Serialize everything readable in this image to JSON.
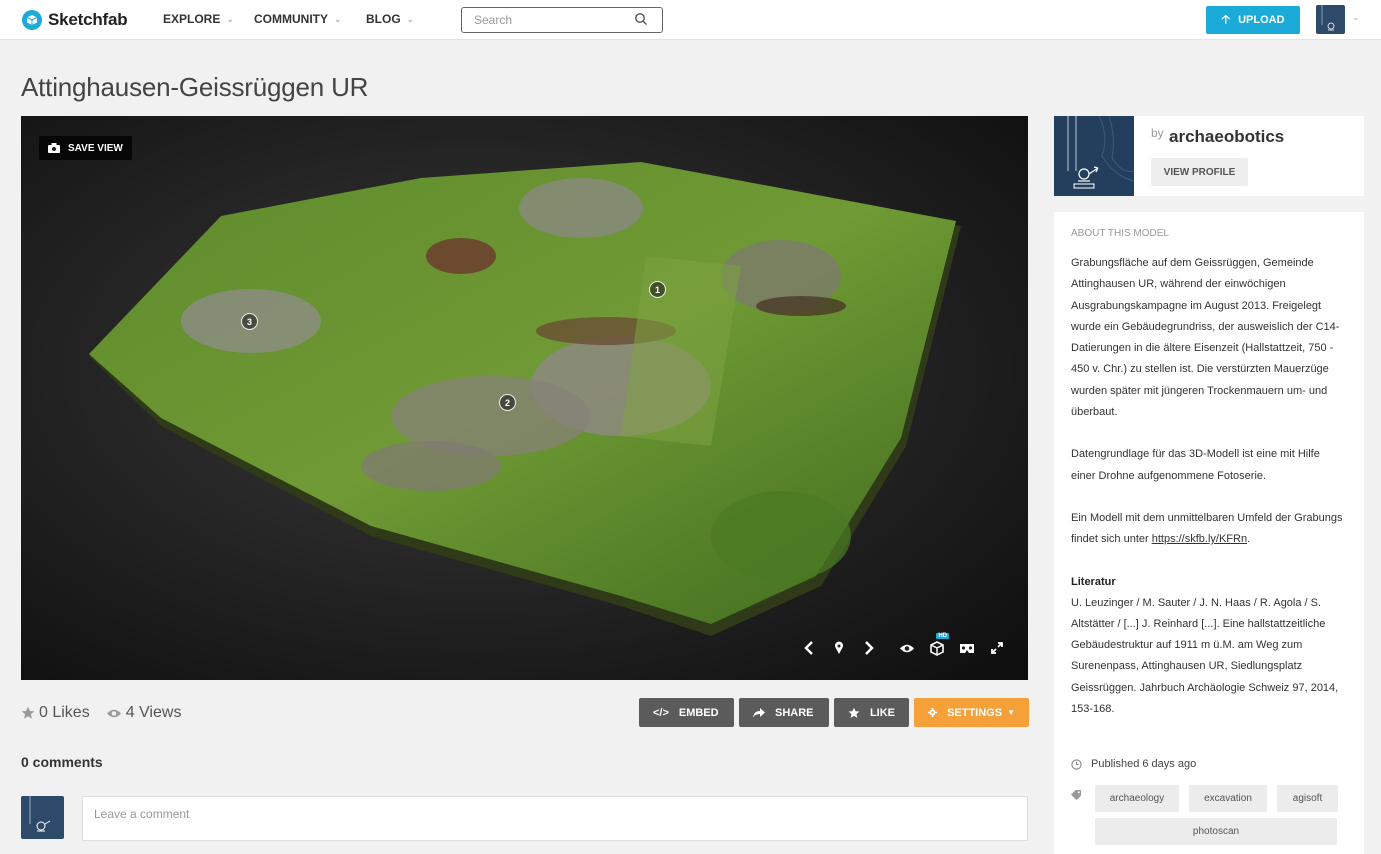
{
  "brand": {
    "name": "Sketchfab",
    "color": "#1caad9"
  },
  "nav": {
    "explore": "EXPLORE",
    "community": "COMMUNITY",
    "blog": "BLOG",
    "search_placeholder": "Search",
    "upload": "UPLOAD"
  },
  "model": {
    "title": "Attinghausen-Geissrüggen UR",
    "save_view": "SAVE VIEW",
    "hotspots": [
      "1",
      "2",
      "3"
    ],
    "hd_badge": "HD"
  },
  "stats": {
    "likes": "0 Likes",
    "views": "4 Views"
  },
  "actions": {
    "embed": "EMBED",
    "share": "SHARE",
    "like": "LIKE",
    "settings": "SETTINGS"
  },
  "comments": {
    "title": "0 comments",
    "placeholder": "Leave a comment"
  },
  "author": {
    "by": "by",
    "name": "archaeobotics",
    "view_profile": "VIEW PROFILE"
  },
  "about": {
    "heading": "ABOUT THIS MODEL",
    "paragraph1": "Grabungsfläche auf dem Geissrüggen, Gemeinde Attinghausen UR, während der einwöchigen Ausgrabungskampagne im August 2013. Freigelegt wurde ein Gebäudegrundriss, der ausweislich der C14-Datierungen in die ältere Eisenzeit (Hallstattzeit, 750 - 450 v. Chr.) zu stellen ist. Die verstürzten Mauerzüge wurden später mit jüngeren Trockenmauern um- und überbaut.",
    "paragraph2": "Datengrundlage für das 3D-Modell ist eine mit Hilfe einer Drohne aufgenommene Fotoserie.",
    "paragraph3_prefix": "Ein Modell mit dem unmittelbaren Umfeld der Grabungs findet sich unter ",
    "paragraph3_link": "https://skfb.ly/KFRn",
    "paragraph3_suffix": ".",
    "lit_heading": "Literatur",
    "literature": "U. Leuzinger / M. Sauter / J. N. Haas / R. Agola / S. Altstätter / [...] J. Reinhard [...]. Eine hallstattzeitliche Gebäudestruktur auf 1911 m ü.M. am Weg zum Surenenpass, Attinghausen UR, Siedlungsplatz Geissrüggen. Jahrbuch Archäologie Schweiz 97, 2014, 153-168.",
    "published": "Published 6 days ago"
  },
  "tags": [
    "archaeology",
    "excavation",
    "agisoft",
    "photoscan"
  ],
  "colors": {
    "settings_orange": "#f6a03a",
    "action_gray": "#5b5b5b",
    "viewer_bg": "#141414"
  }
}
